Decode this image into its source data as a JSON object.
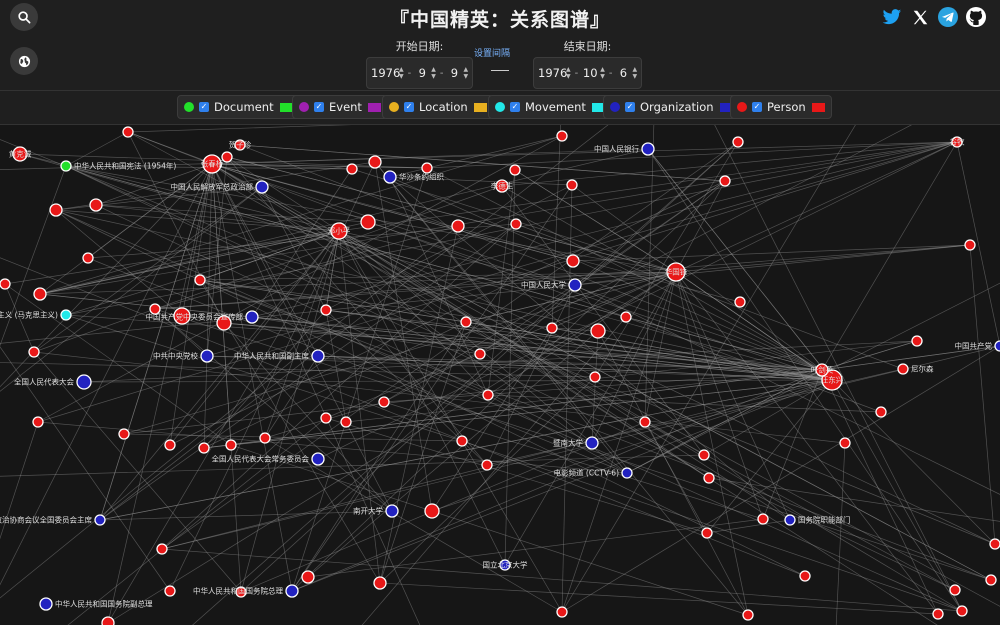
{
  "app": {
    "title": "『中国精英：关系图谱』"
  },
  "header": {
    "search_icon": "search-icon",
    "globe_icon": "globe-icon",
    "social": [
      {
        "name": "twitter-icon",
        "color": "#1da1f2"
      },
      {
        "name": "x-icon",
        "color": "#ffffff"
      },
      {
        "name": "telegram-icon",
        "color": "#2aa3e0"
      },
      {
        "name": "github-icon",
        "color": "#ffffff"
      }
    ]
  },
  "dates": {
    "start_label": "开始日期:",
    "start": {
      "year": "1976",
      "month": "9",
      "day": "9"
    },
    "interval_label": "设置间隔",
    "end_label": "结束日期:",
    "end": {
      "year": "1976",
      "month": "10",
      "day": "6"
    }
  },
  "legend": [
    {
      "label": "Document",
      "color": "#22e02a"
    },
    {
      "label": "Event",
      "color": "#a020b0"
    },
    {
      "label": "Location",
      "color": "#e8b020"
    },
    {
      "label": "Movement",
      "color": "#22e8e8"
    },
    {
      "label": "Organization",
      "color": "#2222c0"
    },
    {
      "label": "Person",
      "color": "#e81818"
    }
  ],
  "nodes": [
    {
      "label": "汪东兴",
      "type": "Person"
    },
    {
      "label": "张春桥",
      "type": "Person"
    },
    {
      "label": "中华人民共和国宪法 (1954年)",
      "type": "Document"
    },
    {
      "label": "贺子珍",
      "type": "Person"
    },
    {
      "label": "黄克诚",
      "type": "Person"
    },
    {
      "label": "华沙条约组织",
      "type": "Organization"
    },
    {
      "label": "李德生",
      "type": "Person"
    },
    {
      "label": "中国人民银行",
      "type": "Organization"
    },
    {
      "label": "谷牧",
      "type": "Person"
    },
    {
      "label": "中国人民解放军总政治部",
      "type": "Organization"
    },
    {
      "label": "邓小平",
      "type": "Person"
    },
    {
      "label": "华国锋",
      "type": "Person"
    },
    {
      "label": "中国人民大学",
      "type": "Organization"
    },
    {
      "label": "修正主义 (马克思主义)",
      "type": "Movement"
    },
    {
      "label": "中国共产党中央委员会宣传部",
      "type": "Organization"
    },
    {
      "label": "中共中央党校",
      "type": "Organization"
    },
    {
      "label": "中华人民共和国副主席",
      "type": "Organization"
    },
    {
      "label": "全国人民代表大会",
      "type": "Organization"
    },
    {
      "label": "叶剑英",
      "type": "Person"
    },
    {
      "label": "尼尔森",
      "type": "Person"
    },
    {
      "label": "全国人民代表大会常务委员会",
      "type": "Organization"
    },
    {
      "label": "暨南大学",
      "type": "Organization"
    },
    {
      "label": "电影频道 (CCTV-6)",
      "type": "Organization"
    },
    {
      "label": "中国人民政治协商会议全国委员会主席",
      "type": "Organization"
    },
    {
      "label": "南开大学",
      "type": "Organization"
    },
    {
      "label": "国务院职能部门",
      "type": "Organization"
    },
    {
      "label": "国立北京大学",
      "type": "Organization"
    },
    {
      "label": "中华人民共和国国务院总理",
      "type": "Organization"
    },
    {
      "label": "中华人民共和国国务院副总理",
      "type": "Organization"
    },
    {
      "label": "中国共产党",
      "type": "Organization"
    }
  ]
}
